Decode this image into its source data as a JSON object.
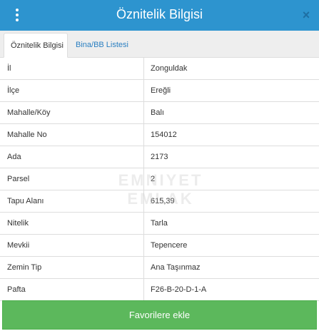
{
  "header": {
    "title": "Öznitelik Bilgisi",
    "close_label": "×"
  },
  "tabs": [
    {
      "label": "Öznitelik Bilgisi",
      "active": true
    },
    {
      "label": "Bina/BB Listesi",
      "active": false
    }
  ],
  "rows": [
    {
      "key": "İl",
      "value": "Zonguldak"
    },
    {
      "key": "İlçe",
      "value": "Ereğli"
    },
    {
      "key": "Mahalle/Köy",
      "value": "Balı"
    },
    {
      "key": "Mahalle No",
      "value": "154012"
    },
    {
      "key": "Ada",
      "value": "2173"
    },
    {
      "key": "Parsel",
      "value": "2"
    },
    {
      "key": "Tapu Alanı",
      "value": "615,39"
    },
    {
      "key": "Nitelik",
      "value": "Tarla"
    },
    {
      "key": "Mevkii",
      "value": "Tepencere"
    },
    {
      "key": "Zemin Tip",
      "value": "Ana Taşınmaz"
    },
    {
      "key": "Pafta",
      "value": "F26-B-20-D-1-A"
    }
  ],
  "watermark": "EMNIYET EMLAK",
  "actions": {
    "favorite_label": "Favorilere ekle"
  },
  "colors": {
    "header_bg": "#2d94cf",
    "tab_link": "#2a7fc1",
    "button_bg": "#5cb85c"
  },
  "icons": {
    "menu": "vertical-dots-icon",
    "close": "close-icon"
  }
}
